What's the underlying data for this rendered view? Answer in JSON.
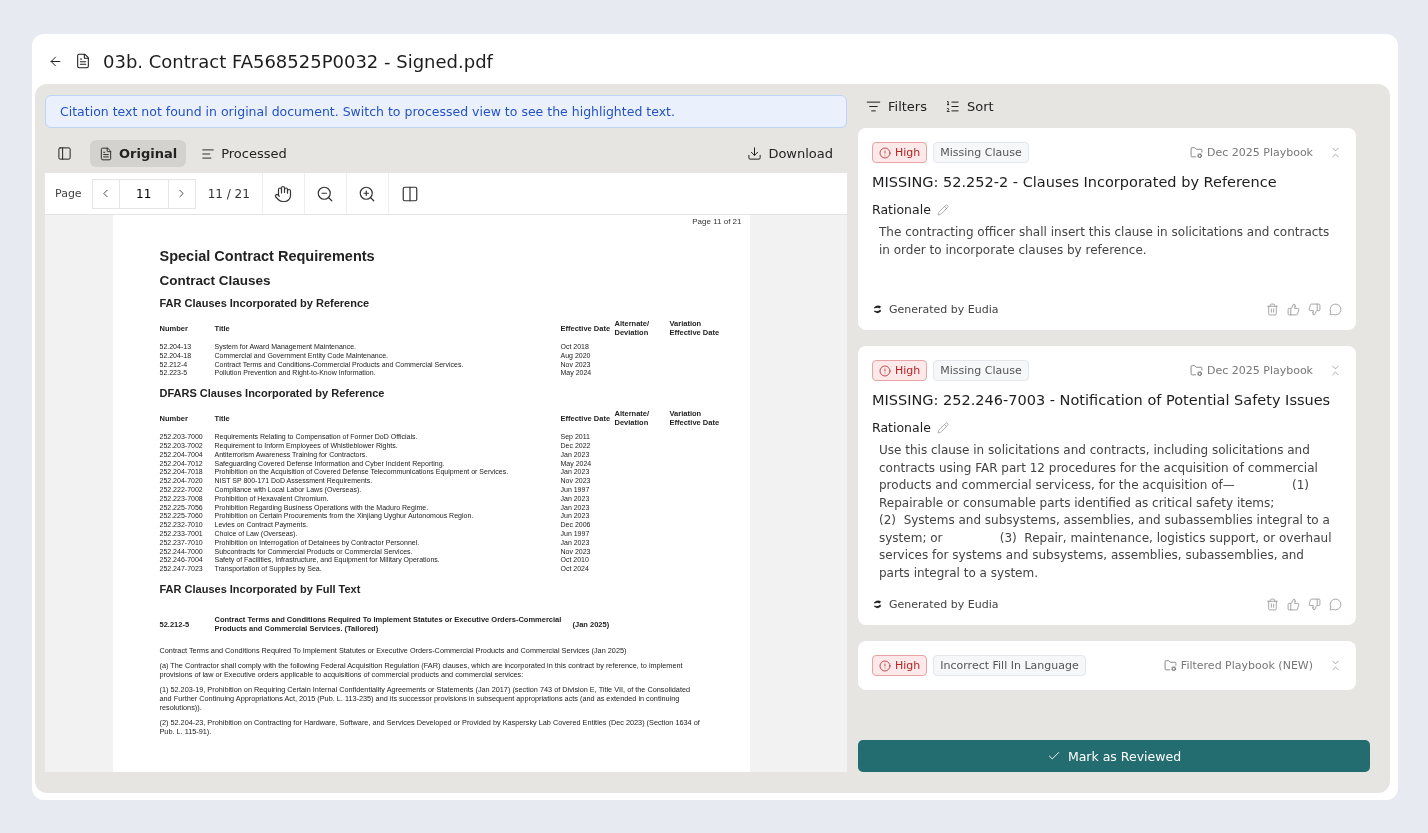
{
  "header": {
    "title": "03b. Contract FA568525P0032 - Signed.pdf"
  },
  "notice": "Citation text not found in original document. Switch to processed view to see the highlighted text.",
  "view_tabs": [
    {
      "label": "Original",
      "selected": true
    },
    {
      "label": "Processed",
      "selected": false
    }
  ],
  "download": "Download",
  "pager": {
    "label": "Page",
    "value": "11",
    "count": "11 / 21"
  },
  "document": {
    "page_label": "Page 11 of 21",
    "title": "Special Contract Requirements",
    "subtitle": "Contract Clauses",
    "sections": [
      {
        "kind": "table",
        "heading": "FAR Clauses Incorporated by Reference",
        "columns": [
          "Number",
          "Title",
          "Effective Date",
          "Alternate/ Deviation",
          "Variation Effective Date"
        ],
        "rows": [
          [
            "52.204-13",
            "System for Award Management Maintenance.",
            "Oct 2018"
          ],
          [
            "52.204-18",
            "Commercial and Government Entity Code Maintenance.",
            "Aug 2020"
          ],
          [
            "52.212-4",
            "Contract Terms and Conditions-Commercial Products and Commercial Services.",
            "Nov 2023"
          ],
          [
            "52.223-5",
            "Pollution Prevention and Right-to-Know Information.",
            "May 2024"
          ]
        ]
      },
      {
        "kind": "table",
        "heading": "DFARS Clauses Incorporated by Reference",
        "columns": [
          "Number",
          "Title",
          "Effective Date",
          "Alternate/ Deviation",
          "Variation Effective Date"
        ],
        "rows": [
          [
            "252.203-7000",
            "Requirements Relating to Compensation of Former DoD Officials.",
            "Sep 2011"
          ],
          [
            "252.203-7002",
            "Requirement to Inform Employees of Whistleblower Rights.",
            "Dec 2022"
          ],
          [
            "252.204-7004",
            "Antiterrorism Awareness Training for Contractors.",
            "Jan 2023"
          ],
          [
            "252.204-7012",
            "Safeguarding Covered Defense Information and Cyber Incident Reporting.",
            "May 2024"
          ],
          [
            "252.204-7018",
            "Prohibition on the Acquisition of Covered Defense Telecommunications Equipment or Services.",
            "Jan 2023"
          ],
          [
            "252.204-7020",
            "NIST SP 800-171 DoD Assessment Requirements.",
            "Nov 2023"
          ],
          [
            "252.222-7002",
            "Compliance with Local Labor Laws (Overseas).",
            "Jun 1997"
          ],
          [
            "252.223-7008",
            "Prohibition of Hexavalent Chromium.",
            "Jan 2023"
          ],
          [
            "252.225-7056",
            "Prohibition Regarding Business Operations with the Maduro Regime.",
            "Jan 2023"
          ],
          [
            "252.225-7060",
            "Prohibition on Certain Procurements from the Xinjiang Uyghur Autonomous Region.",
            "Jun 2023"
          ],
          [
            "252.232-7010",
            "Levies on Contract Payments.",
            "Dec 2006"
          ],
          [
            "252.233-7001",
            "Choice of Law (Overseas).",
            "Jun 1997"
          ],
          [
            "252.237-7010",
            "Prohibition on Interrogation of Detainees by Contractor Personnel.",
            "Jan 2023"
          ],
          [
            "252.244-7000",
            "Subcontracts for Commercial Products or Commercial Services.",
            "Nov 2023"
          ],
          [
            "252.246-7004",
            "Safety of Facilities, Infrastructure, and Equipment for Military Operations.",
            "Oct 2010"
          ],
          [
            "252.247-7023",
            "Transportation of Supplies by Sea.",
            "Oct 2024"
          ]
        ]
      },
      {
        "kind": "fulltext",
        "heading": "FAR Clauses Incorporated by Full Text",
        "clause_number": "52.212-5",
        "clause_title": "Contract Terms and Conditions Required To Implement Statutes or Executive Orders-Commercial Products and Commercial Services. (Tailored)",
        "clause_date": "(Jan 2025)",
        "paragraphs": [
          "Contract Terms and Conditions Required To Implement Statutes or Executive Orders-Commercial Products and Commercial Services (Jan 2025)",
          "(a) The Contractor shall comply with the following Federal Acquisition Regulation (FAR) clauses, which are incorporated in this contract by reference, to implement provisions of law or Executive orders applicable to acquisitions of commercial products and commercial services:",
          "(1) 52.203-19, Prohibition on Requiring Certain Internal Confidentiality Agreements or Statements (Jan 2017) (section 743 of Division E, Title VII, of the Consolidated and Further Continuing Appropriations Act, 2015 (Pub. L. 113-235) and its successor provisions in subsequent appropriations acts (and as extended in continuing resolutions)).",
          "(2) 52.204-23, Prohibition on Contracting for Hardware, Software, and Services Developed or Provided by Kaspersky Lab Covered Entities (Dec 2023) (Section 1634 of Pub. L. 115-91)."
        ]
      }
    ]
  },
  "toolbar": {
    "filters": "Filters",
    "sort": "Sort"
  },
  "findings": [
    {
      "severity": "High",
      "category": "Missing Clause",
      "playbook": "Dec 2025 Playbook",
      "title": "MISSING: 52.252-2 - Clauses Incorporated by Reference",
      "rationale_label": "Rationale",
      "rationale": "The contracting officer shall insert this clause in solicitations and contracts in order to incorporate clauses by reference.",
      "generated_by": "Generated by Eudia"
    },
    {
      "severity": "High",
      "category": "Missing Clause",
      "playbook": "Dec 2025 Playbook",
      "title": "MISSING: 252.246-7003 - Notification of Potential Safety Issues",
      "rationale_label": "Rationale",
      "rationale": "Use this clause in solicitations and contracts, including solicitations and contracts using FAR part 12 procedures for the acquisition of commercial products and commercial servicess, for the acquisition of—               (1)  Repairable or consumable parts identified as critical safety items;               (2)  Systems and subsystems, assemblies, and subassemblies integral to a system; or               (3)  Repair, maintenance, logistics support, or overhaul services for systems and subsystems, assemblies, subassemblies, and parts integral to a system.",
      "generated_by": "Generated by Eudia"
    },
    {
      "severity": "High",
      "category": "Incorrect Fill In Language",
      "playbook": "Filtered Playbook (NEW)"
    }
  ],
  "primary_action": "Mark as Reviewed"
}
